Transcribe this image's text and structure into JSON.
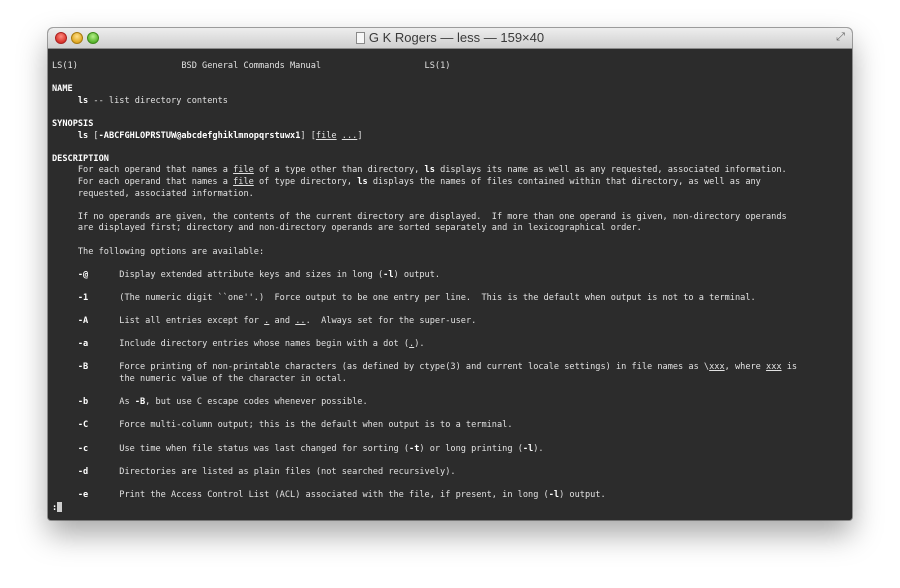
{
  "window": {
    "title": "G K Rogers — less — 159×40",
    "buttons": {
      "close": "close",
      "minimize": "minimize",
      "zoom": "zoom"
    },
    "fullscreen_icon": "fullscreen-arrows-icon"
  },
  "terminal": {
    "header": {
      "left": "LS(1)",
      "center": "BSD General Commands Manual",
      "right": "LS(1)"
    },
    "name_heading": "NAME",
    "name_cmd": "ls",
    "name_desc": " -- list directory contents",
    "synopsis_heading": "SYNOPSIS",
    "synopsis_cmd": "ls",
    "synopsis_open": " [",
    "synopsis_flags": "-ABCFGHLOPRSTUW@abcdefghiklmnopqrstuwx1",
    "synopsis_mid": "] [",
    "synopsis_file": "file",
    "synopsis_space": " ",
    "synopsis_ellipsis": "...",
    "synopsis_close": "]",
    "description_heading": "DESCRIPTION",
    "d1a": "For each operand that names a ",
    "d1file": "file",
    "d1b": " of a type other than directory, ",
    "d1ls": "ls",
    "d1c": " displays its name as well as any requested, associated information.",
    "d2a": "For each operand that names a ",
    "d2file": "file",
    "d2b": " of type directory, ",
    "d2ls": "ls",
    "d2c": " displays the names of files contained within that directory, as well as any",
    "d3": "requested, associated information.",
    "d4": "If no operands are given, the contents of the current directory are displayed.  If more than one operand is given, non-directory operands",
    "d5": "are displayed first; directory and non-directory operands are sorted separately and in lexicographical order.",
    "d6": "The following options are available:",
    "opt_at_flag": "-@",
    "opt_at_a": "Display extended attribute keys and sizes in long (",
    "opt_at_l": "-l",
    "opt_at_b": ") output.",
    "opt_1_flag": "-1",
    "opt_1_text": "(The numeric digit ``one''.)  Force output to be one entry per line.  This is the default when output is not to a terminal.",
    "opt_A_flag": "-A",
    "opt_A_a": "List all entries except for ",
    "opt_A_dot": ".",
    "opt_A_and": " and ",
    "opt_A_dotdot": "..",
    "opt_A_b": ".  Always set for the super-user.",
    "opt_a_flag": "-a",
    "opt_a_a": "Include directory entries whose names begin with a dot (",
    "opt_a_dot": ".",
    "opt_a_b": ").",
    "opt_B_flag": "-B",
    "opt_B_a": "Force printing of non-printable characters (as defined by ctype(3) and current locale settings) in file names as \\",
    "opt_B_xxx1": "xxx",
    "opt_B_b": ", where ",
    "opt_B_xxx2": "xxx",
    "opt_B_c": " is",
    "opt_B_2": "the numeric value of the character in octal.",
    "opt_b_flag": "-b",
    "opt_b_a": "As ",
    "opt_b_B": "-B",
    "opt_b_b": ", but use C escape codes whenever possible.",
    "opt_C_flag": "-C",
    "opt_C_text": "Force multi-column output; this is the default when output is to a terminal.",
    "opt_c_flag": "-c",
    "opt_c_a": "Use time when file status was last changed for sorting (",
    "opt_c_t": "-t",
    "opt_c_b": ") or long printing (",
    "opt_c_l": "-l",
    "opt_c_c": ").",
    "opt_d_flag": "-d",
    "opt_d_text": "Directories are listed as plain files (not searched recursively).",
    "opt_e_flag": "-e",
    "opt_e_a": "Print the Access Control List (ACL) associated with the file, if present, in long (",
    "opt_e_l": "-l",
    "opt_e_b": ") output.",
    "prompt": ":"
  }
}
